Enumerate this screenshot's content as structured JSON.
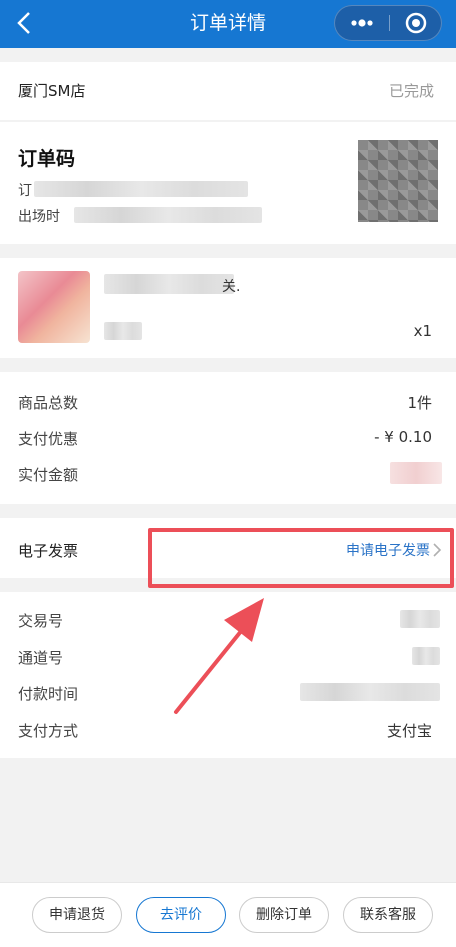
{
  "topbar": {
    "title": "订单详情"
  },
  "store": {
    "name": "厦门SM店",
    "status": "已完成"
  },
  "order_code": {
    "label": "订单码",
    "line1_prefix": "订",
    "line2_prefix": "出场时"
  },
  "product": {
    "name_suffix": "关.",
    "quantity": "x1"
  },
  "summary": {
    "items": [
      {
        "key": "商品总数",
        "value": "1件"
      },
      {
        "key": "支付优惠",
        "value": "- ¥ 0.10"
      },
      {
        "key": "实付金额",
        "value": ""
      }
    ]
  },
  "invoice": {
    "label": "电子发票",
    "link": "申请电子发票"
  },
  "trade": {
    "items": [
      {
        "key": "交易号",
        "value": ""
      },
      {
        "key": "通道号",
        "value": ""
      },
      {
        "key": "付款时间",
        "value": ""
      },
      {
        "key": "支付方式",
        "value": "支付宝"
      }
    ]
  },
  "footer": {
    "buttons": [
      {
        "label": "申请退货"
      },
      {
        "label": "去评价"
      },
      {
        "label": "删除订单"
      },
      {
        "label": "联系客服"
      }
    ]
  },
  "colors": {
    "brand": "#1677d2",
    "highlight": "#ec4f58",
    "link": "#2a73c7"
  },
  "icons": [
    "back-arrow-icon",
    "more-dots-icon",
    "mini-program-close-icon",
    "chevron-right-icon"
  ]
}
